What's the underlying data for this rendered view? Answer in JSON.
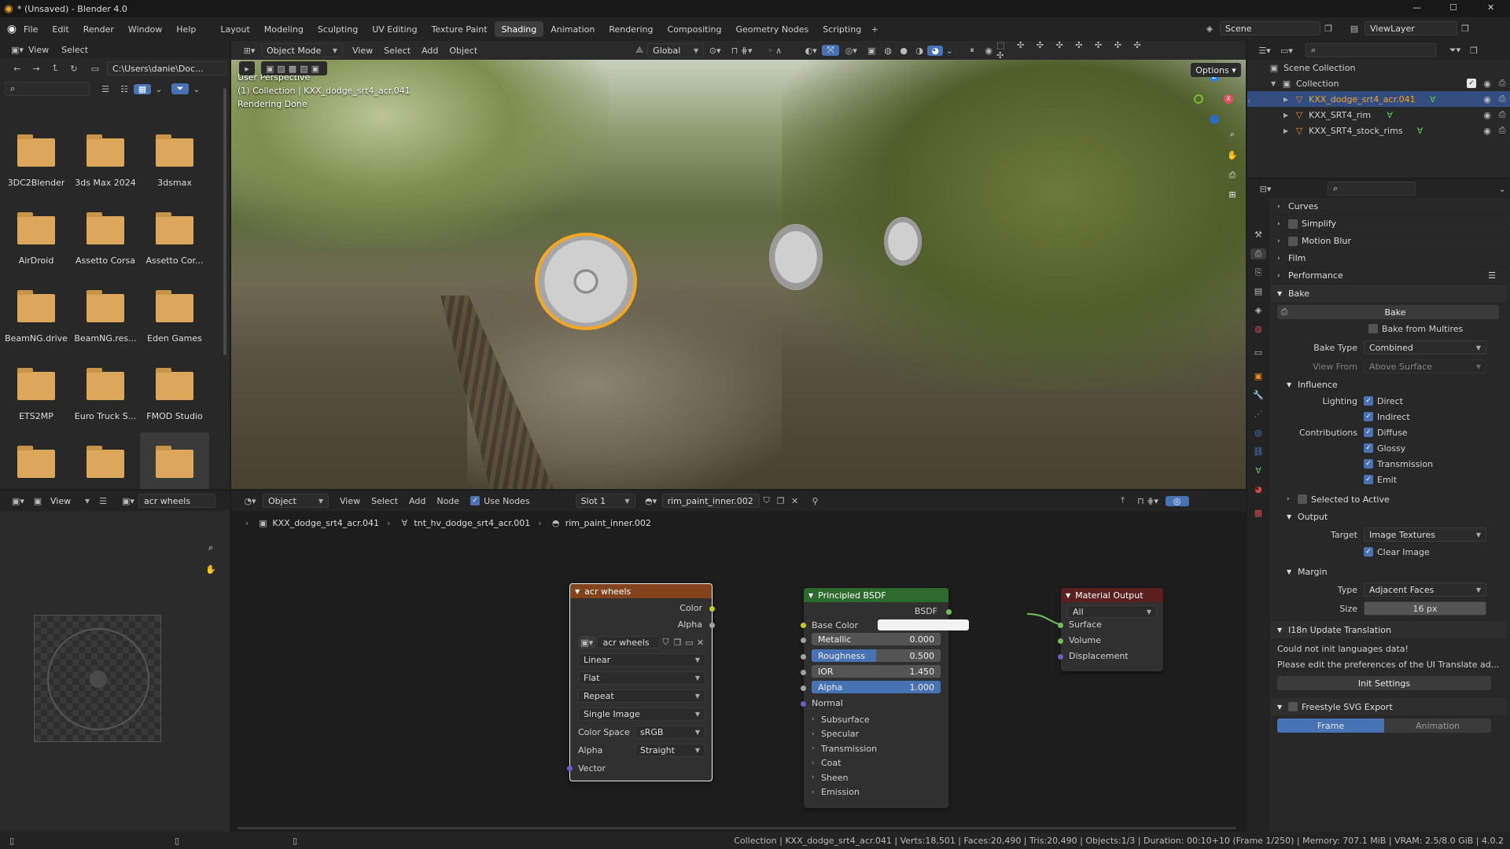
{
  "window": {
    "title": "* (Unsaved) - Blender 4.0",
    "minimize": "—",
    "maximize": "☐",
    "close": "✕"
  },
  "menubar": {
    "items": [
      "File",
      "Edit",
      "Render",
      "Window",
      "Help"
    ]
  },
  "workspaces": [
    "Layout",
    "Modeling",
    "Sculpting",
    "UV Editing",
    "Texture Paint",
    "Shading",
    "Animation",
    "Rendering",
    "Compositing",
    "Geometry Nodes",
    "Scripting"
  ],
  "active_workspace": "Shading",
  "scene": {
    "name": "Scene",
    "view_layer": "ViewLayer"
  },
  "file_browser": {
    "menu": [
      "View",
      "Select"
    ],
    "path": "C:\\Users\\danie\\Doc...",
    "folders": [
      "3DC2Blender",
      "3ds Max 2024",
      "3dsmax",
      "AirDroid",
      "Assetto Corsa",
      "Assetto Cor...",
      "BeamNG.drive",
      "BeamNG.res...",
      "Eden Games",
      "ETS2MP",
      "Euro Truck S...",
      "FMOD Studio",
      "",
      "",
      ""
    ]
  },
  "viewport": {
    "mode": "Object Mode",
    "menu": [
      "View",
      "Select",
      "Add",
      "Object"
    ],
    "orientation": "Global",
    "options": "Options",
    "overlay_lines": [
      "User Perspective",
      "(1) Collection | KXX_dodge_srt4_acr.041",
      "Rendering Done"
    ]
  },
  "image_editor": {
    "view": "View",
    "image_name": "acr wheels"
  },
  "node_editor": {
    "object": "Object",
    "menu": [
      "View",
      "Select",
      "Add",
      "Node"
    ],
    "use_nodes": "Use Nodes",
    "slot": "Slot 1",
    "material": "rim_paint_inner.002",
    "breadcrumb": [
      "KXX_dodge_srt4_acr.041",
      "tnt_hv_dodge_srt4_acr.001",
      "rim_paint_inner.002"
    ],
    "image_node": {
      "title": "acr wheels",
      "out_color": "Color",
      "out_alpha": "Alpha",
      "image": "acr wheels",
      "interpolation": "Linear",
      "projection": "Flat",
      "extension": "Repeat",
      "source": "Single Image",
      "color_space_label": "Color Space",
      "color_space": "sRGB",
      "alpha_label": "Alpha",
      "alpha": "Straight",
      "vector": "Vector"
    },
    "bsdf_node": {
      "title": "Principled BSDF",
      "out": "BSDF",
      "base_color": "Base Color",
      "metallic_label": "Metallic",
      "metallic": "0.000",
      "roughness_label": "Roughness",
      "roughness": "0.500",
      "ior_label": "IOR",
      "ior": "1.450",
      "alpha_label": "Alpha",
      "alpha": "1.000",
      "normal": "Normal",
      "panels": [
        "Subsurface",
        "Specular",
        "Transmission",
        "Coat",
        "Sheen",
        "Emission"
      ],
      "roughness_level": 0.5,
      "alpha_level": 1.0
    },
    "output_node": {
      "title": "Material Output",
      "target": "All",
      "inputs": [
        "Surface",
        "Volume",
        "Displacement"
      ]
    }
  },
  "outliner": {
    "root": "Scene Collection",
    "collection": "Collection",
    "objects": [
      "KXX_dodge_srt4_acr.041",
      "KXX_SRT4_rim",
      "KXX_SRT4_stock_rims"
    ]
  },
  "properties": {
    "sections": [
      "Curves",
      "Simplify",
      "Motion Blur",
      "Film",
      "Performance"
    ],
    "bake": {
      "header": "Bake",
      "button": "Bake",
      "from_multires": "Bake from Multires",
      "bake_type_label": "Bake Type",
      "bake_type": "Combined",
      "view_from_label": "View From",
      "view_from": "Above Surface",
      "influence": "Influence",
      "lighting_label": "Lighting",
      "direct": "Direct",
      "indirect": "Indirect",
      "contributions_label": "Contributions",
      "diffuse": "Diffuse",
      "glossy": "Glossy",
      "transmission": "Transmission",
      "emit": "Emit",
      "selected_to_active": "Selected to Active",
      "output": "Output",
      "target_label": "Target",
      "target": "Image Textures",
      "clear_image": "Clear Image",
      "margin": "Margin",
      "type_label": "Type",
      "type": "Adjacent Faces",
      "size_label": "Size",
      "size": "16 px"
    },
    "i18n": {
      "header": "I18n Update Translation",
      "msg1": "Could not init languages data!",
      "msg2": "Please edit the preferences of the UI Translate ad...",
      "button": "Init Settings"
    },
    "freestyle": {
      "header": "Freestyle SVG Export",
      "frame": "Frame",
      "animation": "Animation"
    }
  },
  "status_bar": {
    "text": "Collection | KXX_dodge_srt4_acr.041 | Verts:18,501 | Faces:20,490 | Tris:20,490 | Objects:1/3 | Duration: 00:10+10 (Frame 1/250) | Memory: 707.1 MiB | VRAM: 2.5/8.0 GiB | 4.0.2"
  },
  "colors": {
    "accent": "#4772b3",
    "selected_orange": "#f5a623",
    "image_header": "#83431d",
    "bsdf_header": "#2d6a2d",
    "output_header": "#5b1f1f"
  }
}
